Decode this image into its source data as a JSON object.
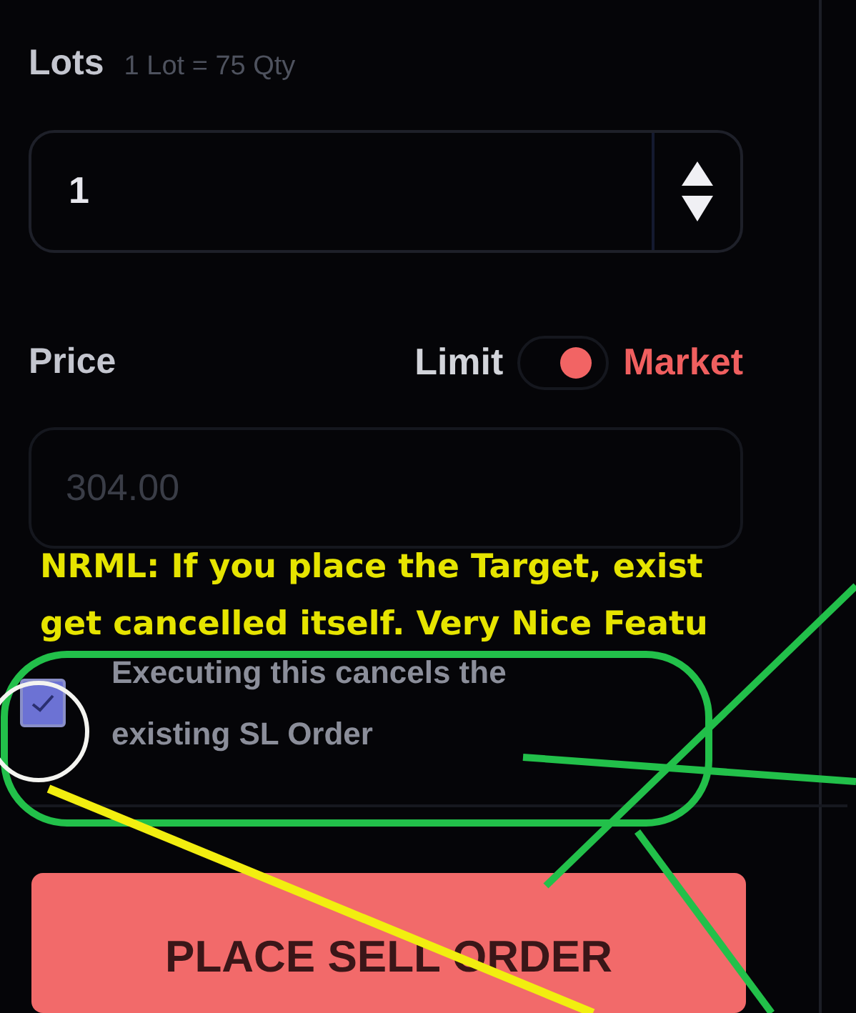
{
  "lots": {
    "label": "Lots",
    "hint": "1 Lot = 75 Qty",
    "value": "1"
  },
  "price": {
    "label": "Price",
    "modes": [
      {
        "label": "Limit",
        "selected": false
      },
      {
        "label": "Market",
        "selected": true
      }
    ],
    "placeholder": "304.00"
  },
  "annotation": {
    "lines": [
      "NRML: If you place the Target, exist",
      "get cancelled itself. Very Nice Featu"
    ]
  },
  "sl_option": {
    "checked": true,
    "text": "Executing this cancels the existing SL Order"
  },
  "button": {
    "label": "PLACE SELL ORDER"
  }
}
